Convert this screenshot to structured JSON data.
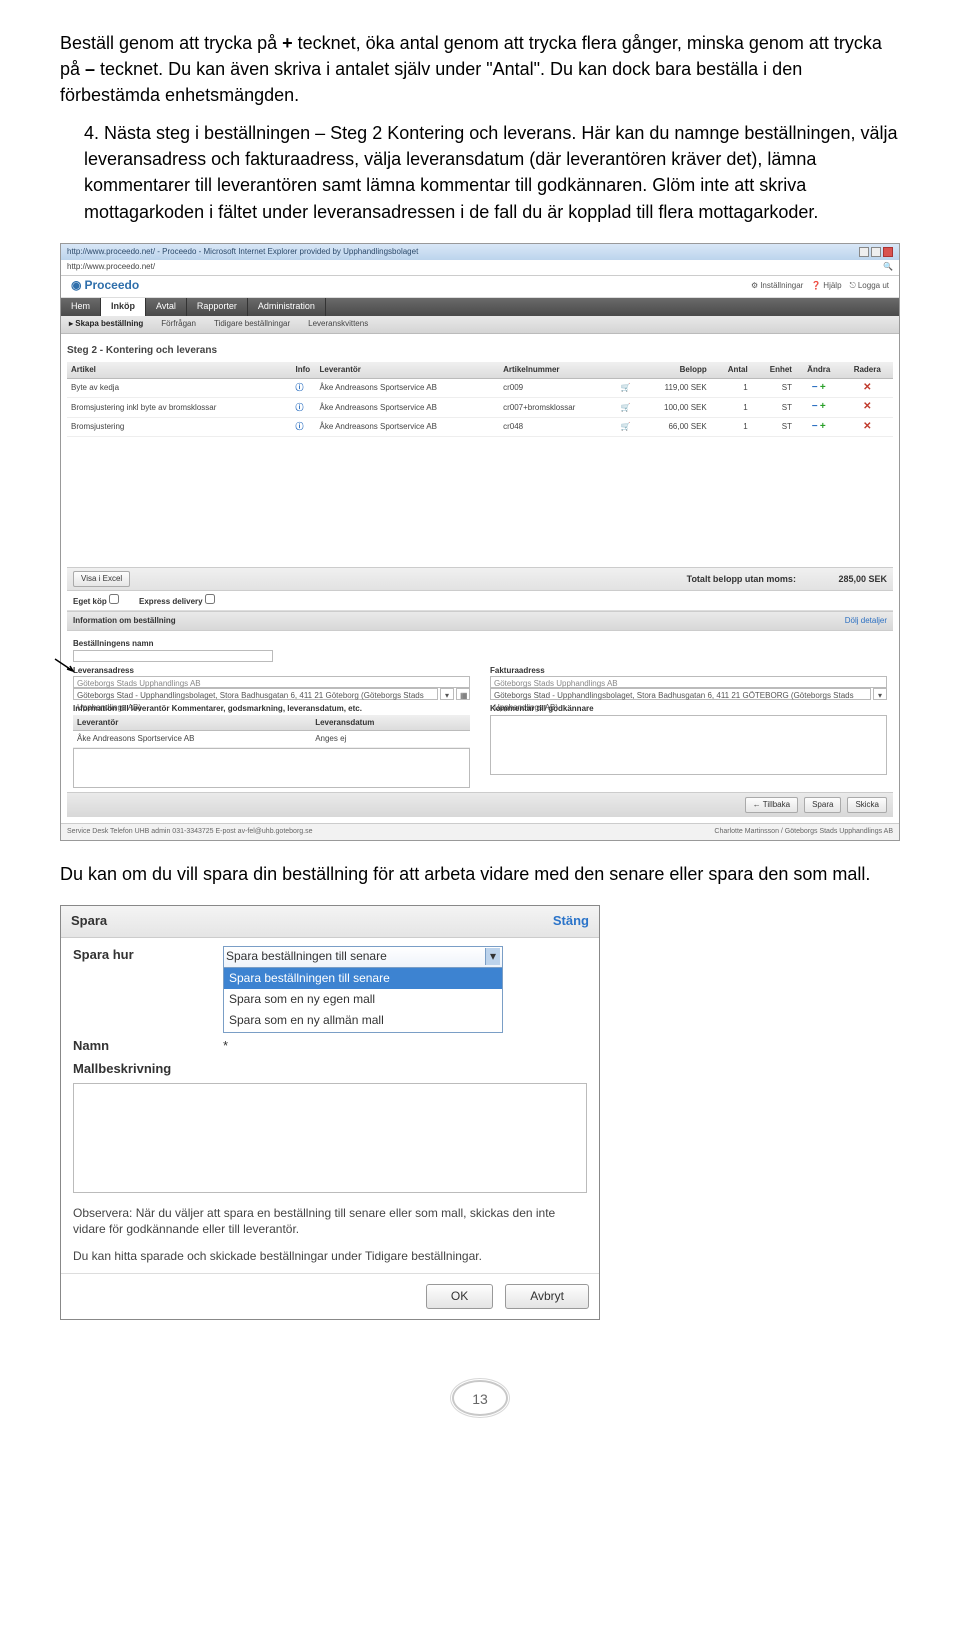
{
  "doc": {
    "p1a": "Beställ genom att trycka på ",
    "p1b": "+",
    "p1c": " tecknet, öka antal genom att trycka flera gånger, minska genom att trycka på ",
    "p1d": "–",
    "p1e": " tecknet. Du kan även skriva i antalet själv under \"Antal\". Du kan dock bara beställa i den förbestämda enhetsmängden.",
    "step_prefix": "4. ",
    "step_text": "Nästa steg i beställningen – Steg 2 Kontering och leverans. Här kan du namnge beställningen, välja leveransadress och fakturaadress, välja leveransdatum (där leverantören kräver det), lämna kommentarer till leverantören samt lämna kommentar till godkännaren. Glöm inte att skriva mottagarkoden i fältet under leveransadressen i de fall du är kopplad till flera mottagarkoder.",
    "p2": "Du kan om du vill spara din beställning för att arbeta vidare med den senare eller spara den som mall.",
    "page_number": "13"
  },
  "app": {
    "window_title": "http://www.proceedo.net/ - Proceedo - Microsoft Internet Explorer provided by Upphandlingsbolaget",
    "url": "http://www.proceedo.net/",
    "brand": "Proceedo",
    "toplinks": {
      "settings": "Inställningar",
      "help": "Hjälp",
      "logout": "Logga ut"
    },
    "menu": {
      "home": "Hem",
      "inkop": "Inköp",
      "avtal": "Avtal",
      "rapporter": "Rapporter",
      "admin": "Administration"
    },
    "sub": {
      "skapa": "▸ Skapa beställning",
      "forfragan": "Förfrågan",
      "tidigare": "Tidigare beställningar",
      "kvittens": "Leveranskvittens"
    },
    "step_title": "Steg 2 - Kontering och leverans",
    "cols": {
      "artikel": "Artikel",
      "info": "Info",
      "lev": "Leverantör",
      "artnr": "Artikelnummer",
      "belopp": "Belopp",
      "antal": "Antal",
      "enhet": "Enhet",
      "andra": "Ändra",
      "radera": "Radera"
    },
    "rows": [
      {
        "artikel": "Byte av kedja",
        "lev": "Åke Andreasons Sportservice AB",
        "artnr": "cr009",
        "belopp": "119,00 SEK",
        "antal": "1",
        "enhet": "ST"
      },
      {
        "artikel": "Bromsjustering inkl byte av bromsklossar",
        "lev": "Åke Andreasons Sportservice AB",
        "artnr": "cr007+bromsklossar",
        "belopp": "100,00 SEK",
        "antal": "1",
        "enhet": "ST"
      },
      {
        "artikel": "Bromsjustering",
        "lev": "Åke Andreasons Sportservice AB",
        "artnr": "cr048",
        "belopp": "66,00 SEK",
        "antal": "1",
        "enhet": "ST"
      }
    ],
    "excel_btn": "Visa i Excel",
    "total_label": "Totalt belopp utan moms:",
    "total_value": "285,00 SEK",
    "check1": "Eget köp",
    "check2": "Express delivery",
    "info_header": "Information om beställning",
    "info_link": "Dölj detaljer",
    "form": {
      "name_lbl": "Beställningens namn",
      "levadr_lbl": "Leveransadress",
      "levadr_line1": "Göteborgs Stads Upphandlings AB",
      "levadr_line2": "Göteborgs Stad - Upphandlingsbolaget, Stora Badhusgatan 6, 411 21 Göteborg (Göteborgs Stads Upphandlings AB)",
      "fakadr_lbl": "Fakturaadress",
      "fakadr_line1": "Göteborgs Stads Upphandlings AB",
      "fakadr_line2": "Göteborgs Stad - Upphandlingsbolaget, Stora Badhusgatan 6, 411 21 GÖTEBORG (Göteborgs Stads Upphandlings AB)",
      "info_lev_lbl": "Information till leverantör Kommentarer, godsmarkning, leveransdatum, etc.",
      "komm_lbl": "Kommentar till godkännare",
      "lev_hdr": "Leverantör",
      "levdatum_hdr": "Leveransdatum",
      "lev_name": "Åke Andreasons Sportservice AB",
      "lev_date": "Anges ej"
    },
    "nav": {
      "back": "←  Tillbaka",
      "save": "Spara",
      "send": "Skicka"
    },
    "footer_left": "Service Desk Telefon UHB admin 031-3343725   E-post av-fel@uhb.goteborg.se",
    "footer_right": "Charlotte Martinsson / Göteborgs Stads Upphandlings AB"
  },
  "dlg": {
    "title": "Spara",
    "close": "Stäng",
    "how_lbl": "Spara hur",
    "name_lbl": "Namn",
    "desc_lbl": "Mallbeskrivning",
    "selected": "Spara beställningen till senare",
    "options": [
      "Spara beställningen till senare",
      "Spara som en ny egen mall",
      "Spara som en ny allmän mall"
    ],
    "note1": "Observera: När du väljer att spara en beställning till senare eller som mall, skickas den inte vidare för godkännande eller till leverantör.",
    "note2": "Du kan hitta sparade och skickade beställningar under Tidigare beställningar.",
    "ok": "OK",
    "cancel": "Avbryt"
  }
}
